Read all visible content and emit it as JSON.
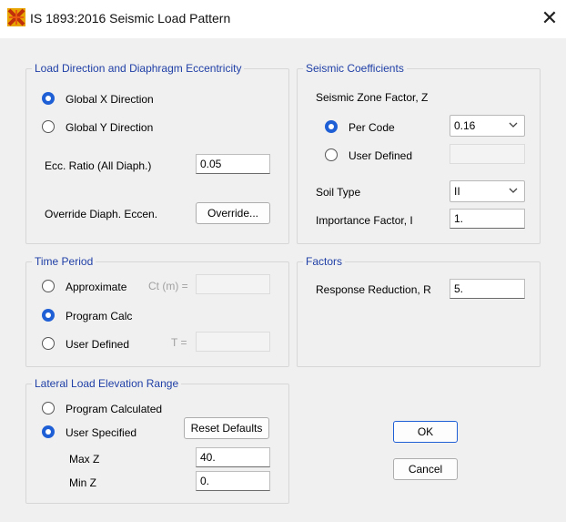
{
  "window": {
    "title": "IS 1893:2016 Seismic Load Pattern",
    "icon": "etabs-app-icon",
    "close_glyph": "✕"
  },
  "load_direction": {
    "legend": "Load Direction and Diaphragm Eccentricity",
    "option_x": "Global  X  Direction",
    "option_y": "Global  Y  Direction",
    "selected": "x",
    "ecc_label": "Ecc. Ratio (All Diaph.)",
    "ecc_value": "0.05",
    "override_label": "Override Diaph. Eccen.",
    "override_button": "Override..."
  },
  "seismic_coefficients": {
    "legend": "Seismic Coefficients",
    "zone_label": "Seismic Zone Factor, Z",
    "per_code": "Per Code",
    "user_defined": "User Defined",
    "selected": "per_code",
    "zone_value": "0.16",
    "soil_label": "Soil Type",
    "soil_value": "II",
    "importance_label": "Importance Factor, I",
    "importance_value": "1."
  },
  "time_period": {
    "legend": "Time Period",
    "approximate": "Approximate",
    "ct_label": "Ct (m) =",
    "program_calc": "Program Calc",
    "user_defined": "User Defined",
    "t_label": "T =",
    "selected": "program_calc"
  },
  "factors": {
    "legend": "Factors",
    "r_label": "Response Reduction, R",
    "r_value": "5."
  },
  "elevation_range": {
    "legend": "Lateral Load Elevation Range",
    "program_calculated": "Program Calculated",
    "user_specified": "User Specified",
    "selected": "user_specified",
    "reset_button": "Reset Defaults",
    "max_label": "Max Z",
    "max_value": "40.",
    "min_label": "Min Z",
    "min_value": "0."
  },
  "buttons": {
    "ok": "OK",
    "cancel": "Cancel"
  },
  "colors": {
    "accent": "#1f5fd6",
    "legend_text": "#1f3fa6",
    "background": "#f0f0f0"
  }
}
